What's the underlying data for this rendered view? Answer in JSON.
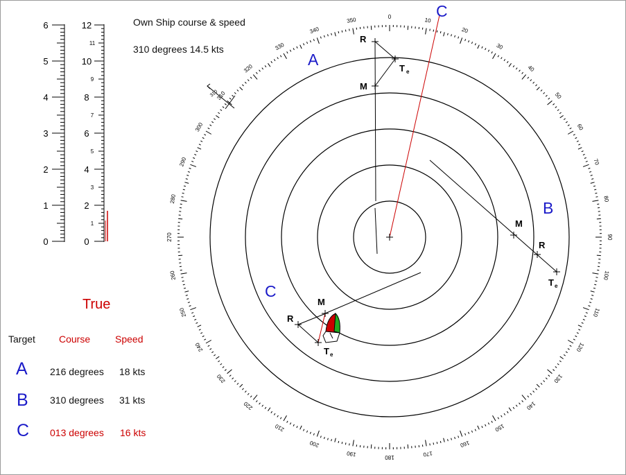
{
  "own_ship": {
    "title": "Own  Ship course & speed",
    "value": "310 degrees  14.5 kts"
  },
  "scale_left": {
    "major_labels": [
      "0",
      "1",
      "2",
      "3",
      "4",
      "5",
      "6"
    ]
  },
  "scale_right": {
    "major_labels": [
      "0",
      "2",
      "4",
      "6",
      "8",
      "10",
      "12"
    ],
    "minor_labels": [
      "1",
      "3",
      "5",
      "7",
      "9",
      "11"
    ]
  },
  "mode_label": "True",
  "table": {
    "headers": {
      "target": "Target",
      "course": "Course",
      "speed": "Speed"
    },
    "rows": [
      {
        "id": "A",
        "course": "216 degrees",
        "speed": "18 kts",
        "highlight": false
      },
      {
        "id": "B",
        "course": "310 degrees",
        "speed": "31 kts",
        "highlight": false
      },
      {
        "id": "C",
        "course": "013 degrees",
        "speed": "16 kts",
        "highlight": true
      }
    ]
  },
  "plot": {
    "bearing_labels": [
      "0",
      "10",
      "20",
      "30",
      "40",
      "50",
      "60",
      "70",
      "80",
      "90",
      "100",
      "110",
      "120",
      "130",
      "140",
      "150",
      "160",
      "170",
      "180",
      "190",
      "200",
      "210",
      "220",
      "230",
      "240",
      "250",
      "260",
      "270",
      "280",
      "290",
      "300",
      "310",
      "320",
      "330",
      "340",
      "350"
    ],
    "target_letters": [
      "A",
      "B",
      "C",
      "C"
    ],
    "point_labels": {
      "R": "R",
      "M": "M",
      "T": "T",
      "e": "e"
    }
  },
  "colors": {
    "blue": "#1a1ac8",
    "red": "#cc0000",
    "green": "#22aa22",
    "black": "#000000"
  }
}
